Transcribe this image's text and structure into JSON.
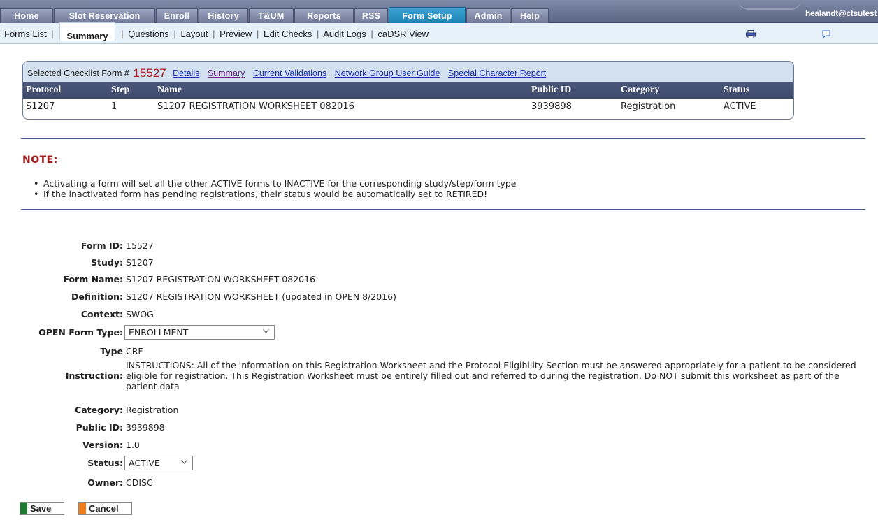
{
  "topnav": {
    "tabs": [
      {
        "label": "Home"
      },
      {
        "label": "Slot Reservation"
      },
      {
        "label": "Enroll"
      },
      {
        "label": "History"
      },
      {
        "label": "T&UM"
      },
      {
        "label": "Reports"
      },
      {
        "label": "RSS"
      },
      {
        "label": "Form Setup",
        "active": true
      },
      {
        "label": "Admin"
      },
      {
        "label": "Help"
      }
    ],
    "user": "healandt@ctsutest"
  },
  "subnav": {
    "forms_list": "Forms List",
    "summary": "Summary",
    "questions": "Questions",
    "layout": "Layout",
    "preview": "Preview",
    "edit_checks": "Edit Checks",
    "audit_logs": "Audit Logs",
    "cadsr_view": "caDSR View",
    "sep": "|"
  },
  "checklist": {
    "label": "Selected Checklist Form #",
    "number": "15527",
    "links": {
      "details": "Details",
      "summary": "Summary",
      "current_validations": "Current Validations",
      "network_group_user_guide": "Network Group User Guide",
      "special_character_report": "Special Character Report"
    },
    "columns": {
      "protocol": "Protocol",
      "step": "Step",
      "name": "Name",
      "public_id": "Public ID",
      "category": "Category",
      "status": "Status"
    },
    "row": {
      "protocol": "S1207",
      "step": "1",
      "name": "S1207 REGISTRATION WORKSHEET 082016",
      "public_id": "3939898",
      "category": "Registration",
      "status": "ACTIVE"
    }
  },
  "note": {
    "title": "NOTE:",
    "items": [
      "Activating a form will set all the other ACTIVE forms to INACTIVE for the corresponding study/step/form type",
      "If the inactivated form has pending registrations, their status would be automatically set to RETIRED!"
    ]
  },
  "form": {
    "form_id_label": "Form ID:",
    "form_id": "15527",
    "study_label": "Study:",
    "study": "S1207",
    "form_name_label": "Form Name:",
    "form_name": "S1207 REGISTRATION WORKSHEET 082016",
    "definition_label": "Definition:",
    "definition": "S1207 REGISTRATION WORKSHEET (updated in OPEN 8/2016)",
    "context_label": "Context:",
    "context": "SWOG",
    "open_form_type_label": "OPEN Form Type:",
    "open_form_type": "ENROLLMENT",
    "type_label": "Type",
    "type": "CRF",
    "instruction_label": "Instruction:",
    "instruction": "INSTRUCTIONS: All of the information on this Registration Worksheet and the Protocol Eligibility Section must be answered appropriately for a patient to be considered eligible for registration. This Registration Worksheet must be entirely filled out and referred to during the registration. Do NOT submit this worksheet as part of the patient data",
    "category_label": "Category:",
    "category": "Registration",
    "public_id_label": "Public ID:",
    "public_id": "3939898",
    "version_label": "Version:",
    "version": "1.0",
    "status_label": "Status:",
    "status": "ACTIVE",
    "owner_label": "Owner:",
    "owner": "CDISC"
  },
  "buttons": {
    "save": "Save",
    "cancel": "Cancel"
  },
  "colors": {
    "save_bar": "#1e7a2e",
    "cancel_bar": "#f07d1e",
    "active_tab": "#1b7fb3",
    "note_red": "#a31c1c"
  },
  "icons": {
    "print": "printer-icon",
    "chat": "chat-bubble-icon"
  }
}
